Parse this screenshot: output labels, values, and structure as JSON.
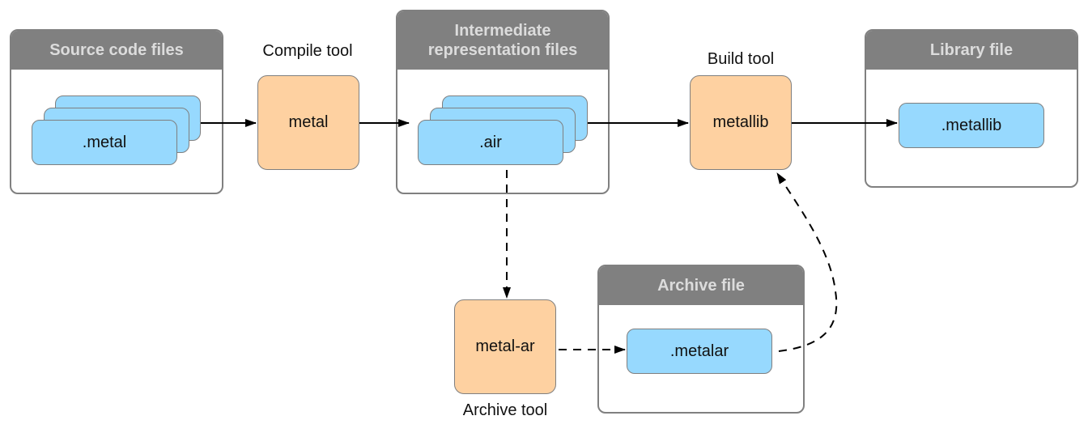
{
  "groups": {
    "source": {
      "title": "Source code files",
      "file_label": ".metal"
    },
    "intermediate": {
      "title_line1": "Intermediate",
      "title_line2": "representation files",
      "file_label": ".air"
    },
    "library": {
      "title": "Library file",
      "file_label": ".metallib"
    },
    "archive": {
      "title": "Archive file",
      "file_label": ".metalar"
    }
  },
  "tools": {
    "compile": {
      "caption": "Compile tool",
      "label": "metal"
    },
    "build": {
      "caption": "Build tool",
      "label": "metallib"
    },
    "archive": {
      "caption": "Archive tool",
      "label": "metal-ar"
    }
  },
  "colors": {
    "group_header": "#808080",
    "group_header_text": "#dcdcdc",
    "file_fill": "#97d9fe",
    "tool_fill": "#fed1a1",
    "border": "#7f7f7f"
  },
  "edges": [
    {
      "from": ".metal",
      "to": "metal",
      "style": "solid"
    },
    {
      "from": "metal",
      "to": ".air",
      "style": "solid"
    },
    {
      "from": ".air",
      "to": "metallib",
      "style": "solid"
    },
    {
      "from": "metallib",
      "to": ".metallib",
      "style": "solid"
    },
    {
      "from": ".air",
      "to": "metal-ar",
      "style": "dashed"
    },
    {
      "from": "metal-ar",
      "to": ".metalar",
      "style": "dashed"
    },
    {
      "from": ".metalar",
      "to": "metallib",
      "style": "dashed"
    }
  ]
}
